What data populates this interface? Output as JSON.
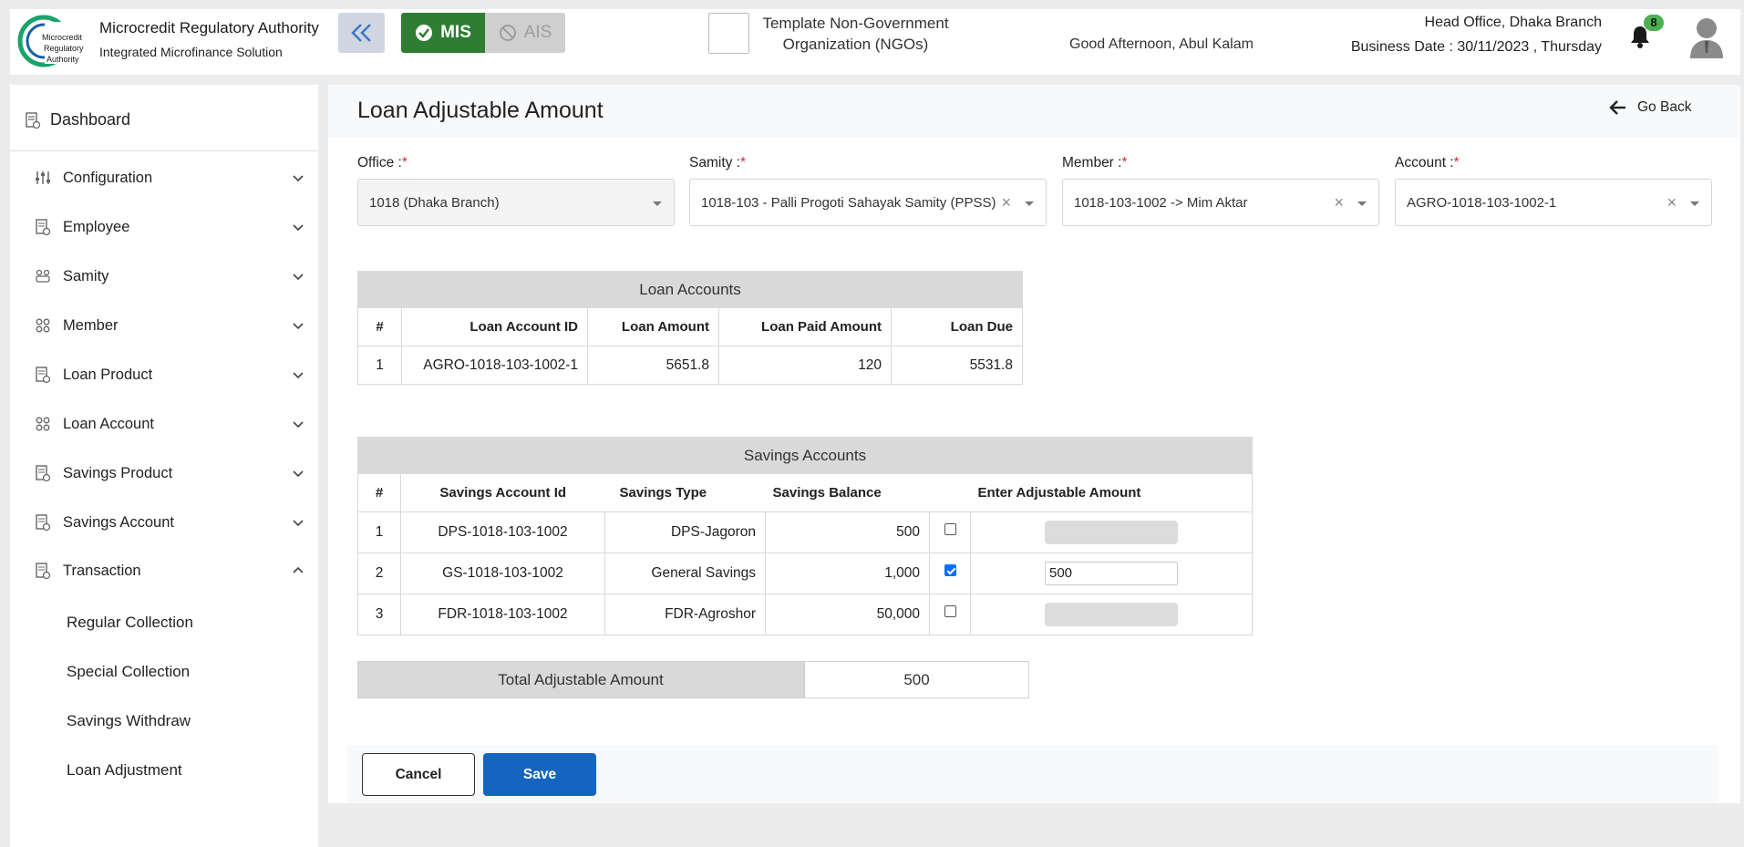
{
  "header": {
    "brand_title": "Microcredit Regulatory Authority",
    "brand_subtitle": "Integrated Microfinance Solution",
    "logo_text": "Microcredit Regulatory Authority",
    "mis_label": "MIS",
    "ais_label": "AIS",
    "org_name": "Template Non-Government Organization (NGOs)",
    "greeting": "Good Afternoon, Abul Kalam",
    "office": "Head Office, Dhaka Branch",
    "business_date": "Business Date : 30/11/2023 , Thursday",
    "notification_count": "8"
  },
  "sidebar": {
    "dashboard": "Dashboard",
    "items": [
      {
        "label": "Configuration",
        "icon": "sliders-icon"
      },
      {
        "label": "Employee",
        "icon": "document-icon"
      },
      {
        "label": "Samity",
        "icon": "group-icon"
      },
      {
        "label": "Member",
        "icon": "users-icon"
      },
      {
        "label": "Loan Product",
        "icon": "document-icon"
      },
      {
        "label": "Loan Account",
        "icon": "users-icon"
      },
      {
        "label": "Savings Product",
        "icon": "document-icon"
      },
      {
        "label": "Savings Account",
        "icon": "document-icon"
      },
      {
        "label": "Transaction",
        "icon": "document-icon"
      }
    ],
    "sub_items": [
      "Regular Collection",
      "Special Collection",
      "Savings Withdraw",
      "Loan Adjustment"
    ]
  },
  "page": {
    "title": "Loan Adjustable Amount",
    "go_back": "Go Back"
  },
  "form": {
    "office": {
      "label": "Office :",
      "value": "1018 (Dhaka Branch)"
    },
    "samity": {
      "label": "Samity :",
      "value": "1018-103 - Palli Progoti Sahayak Samity (PPSS)"
    },
    "member": {
      "label": "Member :",
      "value": "1018-103-1002 -> Mim Aktar"
    },
    "account": {
      "label": "Account :",
      "value": "AGRO-1018-103-1002-1"
    },
    "required_mark": "*"
  },
  "loan_table": {
    "caption": "Loan Accounts",
    "headers": [
      "#",
      "Loan Account ID",
      "Loan Amount",
      "Loan Paid Amount",
      "Loan Due"
    ],
    "rows": [
      [
        "1",
        "AGRO-1018-103-1002-1",
        "5651.8",
        "120",
        "5531.8"
      ]
    ]
  },
  "savings_table": {
    "caption": "Savings Accounts",
    "headers": [
      "#",
      "Savings Account Id",
      "Savings Type",
      "Savings Balance",
      "Enter Adjustable Amount"
    ],
    "rows": [
      {
        "no": "1",
        "id": "DPS-1018-103-1002",
        "type": "DPS-Jagoron",
        "balance": "500",
        "checked": false,
        "amount": ""
      },
      {
        "no": "2",
        "id": "GS-1018-103-1002",
        "type": "General Savings",
        "balance": "1,000",
        "checked": true,
        "amount": "500"
      },
      {
        "no": "3",
        "id": "FDR-1018-103-1002",
        "type": "FDR-Agroshor",
        "balance": "50,000",
        "checked": false,
        "amount": ""
      }
    ]
  },
  "total": {
    "label": "Total Adjustable Amount",
    "value": "500"
  },
  "buttons": {
    "cancel": "Cancel",
    "save": "Save"
  },
  "colors": {
    "mis_green": "#2e7d32",
    "save_blue": "#1565c0",
    "badge_green": "#4caf50",
    "required_red": "#d32f2f"
  }
}
